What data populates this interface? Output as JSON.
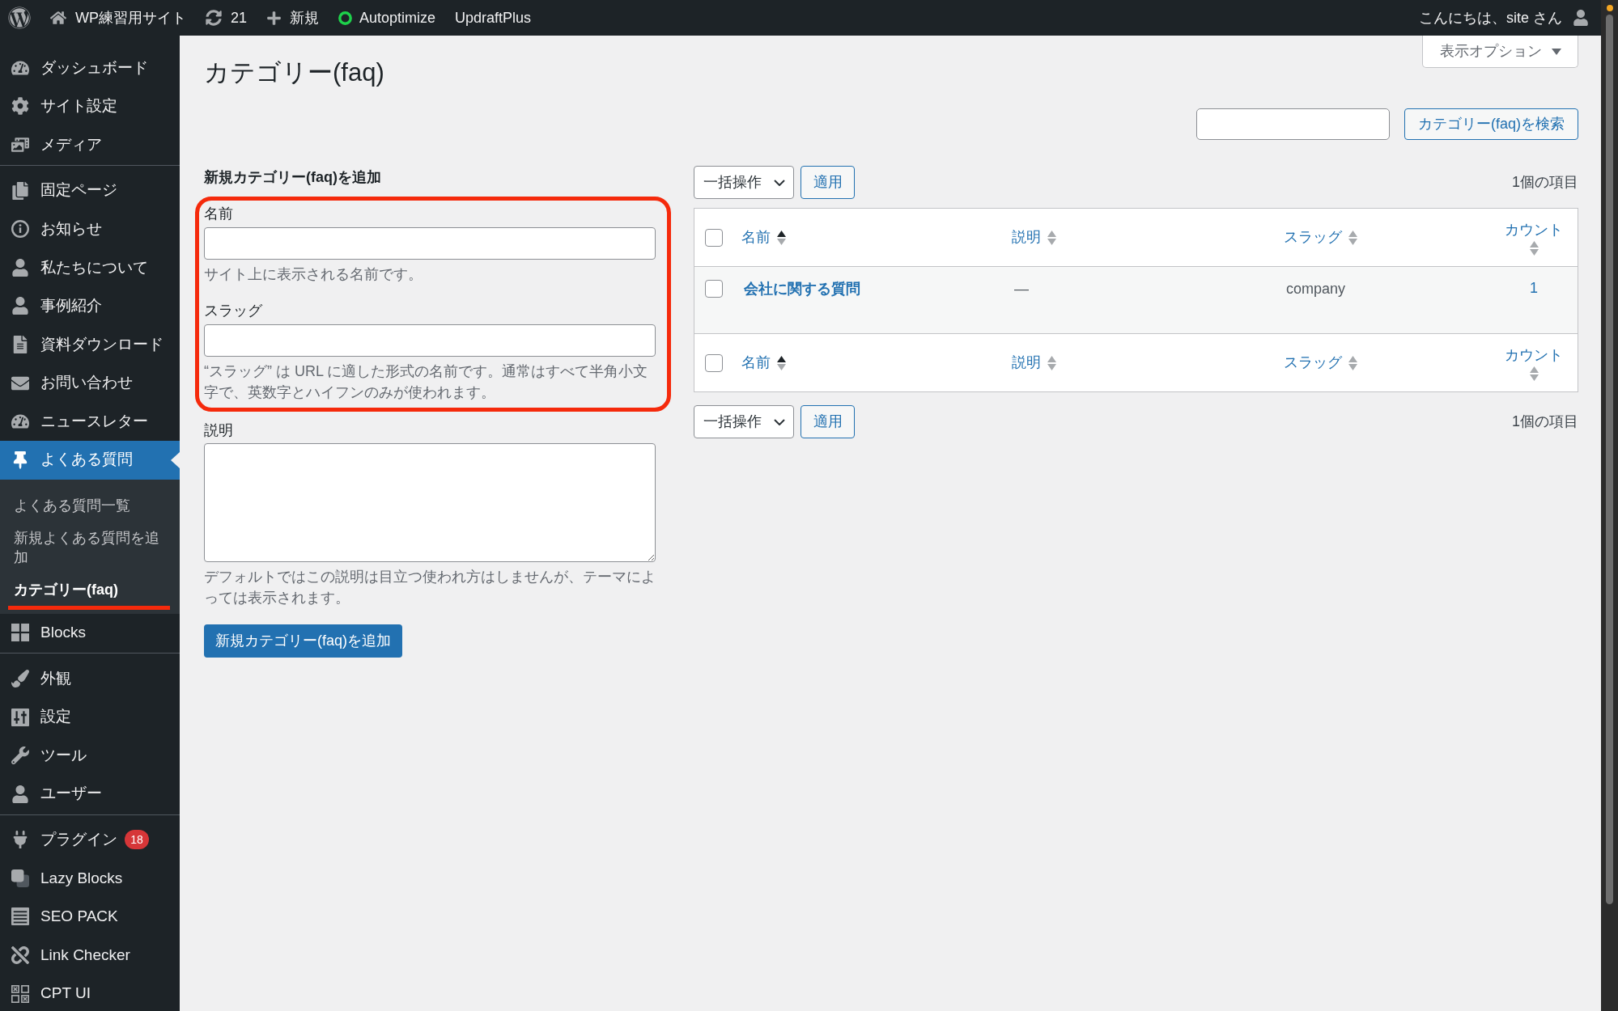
{
  "top_bar": {
    "items": [
      {
        "kind": "logo"
      },
      {
        "kind": "site",
        "label": "WP練習用サイト"
      },
      {
        "kind": "updates",
        "label": "21"
      },
      {
        "kind": "new",
        "label": "新規"
      },
      {
        "kind": "status",
        "label": "Autoptimize"
      },
      {
        "kind": "plain",
        "label": "UpdraftPlus"
      }
    ],
    "greeting": "こんにちは、site さん"
  },
  "sidebar": {
    "groups": [
      {
        "items": [
          {
            "label": "ダッシュボード",
            "selected": false
          },
          {
            "label": "サイト設定",
            "selected": false
          },
          {
            "label": "メディア",
            "selected": false
          }
        ]
      },
      {
        "items": [
          {
            "label": "固定ページ",
            "selected": false
          },
          {
            "label": "お知らせ",
            "selected": false
          },
          {
            "label": "私たちについて",
            "selected": false
          },
          {
            "label": "事例紹介",
            "selected": false
          },
          {
            "label": "資料ダウンロード",
            "selected": false
          },
          {
            "label": "お問い合わせ",
            "selected": false
          },
          {
            "label": "ニュースレター",
            "selected": false
          },
          {
            "label": "よくある質問",
            "selected": true,
            "children": [
              {
                "label": "よくある質問一覧",
                "selected": false,
                "highlighted": false
              },
              {
                "label": "新規よくある質問を追加",
                "selected": false,
                "highlighted": false
              },
              {
                "label": "カテゴリー(faq)",
                "selected": true,
                "highlighted": true
              }
            ]
          },
          {
            "label": "Blocks",
            "selected": false
          }
        ]
      },
      {
        "items": [
          {
            "label": "外観",
            "selected": false
          },
          {
            "label": "設定",
            "selected": false
          },
          {
            "label": "ツール",
            "selected": false
          },
          {
            "label": "ユーザー",
            "selected": false
          }
        ]
      },
      {
        "items": [
          {
            "label": "プラグイン",
            "selected": false,
            "badge": "18"
          },
          {
            "label": "Lazy Blocks",
            "selected": false
          },
          {
            "label": "SEO PACK",
            "selected": false
          },
          {
            "label": "Link Checker",
            "selected": false
          },
          {
            "label": "CPT UI",
            "selected": false
          }
        ]
      }
    ]
  },
  "page": {
    "screen_options": "表示オプション",
    "title": "カテゴリー(faq)",
    "search": {
      "button": "カテゴリー(faq)を検索"
    },
    "add_form": {
      "heading": "新規カテゴリー(faq)を追加",
      "fields": [
        {
          "kind": "input",
          "label": "名前",
          "hint": "サイト上に表示される名前です。",
          "highlighted": true
        },
        {
          "kind": "input",
          "label": "スラッグ",
          "hint": "“スラッグ” は URL に適した形式の名前です。通常はすべて半角小文字で、英数字とハイフンのみが使われます。",
          "highlighted": true
        },
        {
          "kind": "textarea",
          "label": "説明",
          "hint": "デフォルトではこの説明は目立つ使われ方はしませんが、テーマによっては表示されます。",
          "highlighted": false
        }
      ],
      "submit": "新規カテゴリー(faq)を追加"
    },
    "top_nav": {
      "bulk_select": "一括操作",
      "apply": "適用",
      "count": "1個の項目"
    },
    "table": {
      "header": {
        "checked": false,
        "columns": [
          {
            "kind": "name",
            "label": "名前",
            "sorted": true
          },
          {
            "kind": "text",
            "label": "説明",
            "sorted": false
          },
          {
            "kind": "text",
            "label": "スラッグ",
            "sorted": false
          },
          {
            "kind": "count",
            "label": "カウント",
            "sorted": false
          }
        ]
      },
      "rows": [
        {
          "checked": false,
          "cells": [
            "会社に関する質問",
            "—",
            "company",
            "1"
          ]
        }
      ],
      "footer": {
        "checked": false,
        "columns": [
          {
            "kind": "name",
            "label": "名前",
            "sorted": true
          },
          {
            "kind": "text",
            "label": "説明",
            "sorted": false
          },
          {
            "kind": "text",
            "label": "スラッグ",
            "sorted": false
          },
          {
            "kind": "count",
            "label": "カウント",
            "sorted": false
          }
        ]
      }
    },
    "bottom_nav": {
      "bulk_select": "一括操作",
      "apply": "適用",
      "count": "1個の項目"
    }
  }
}
